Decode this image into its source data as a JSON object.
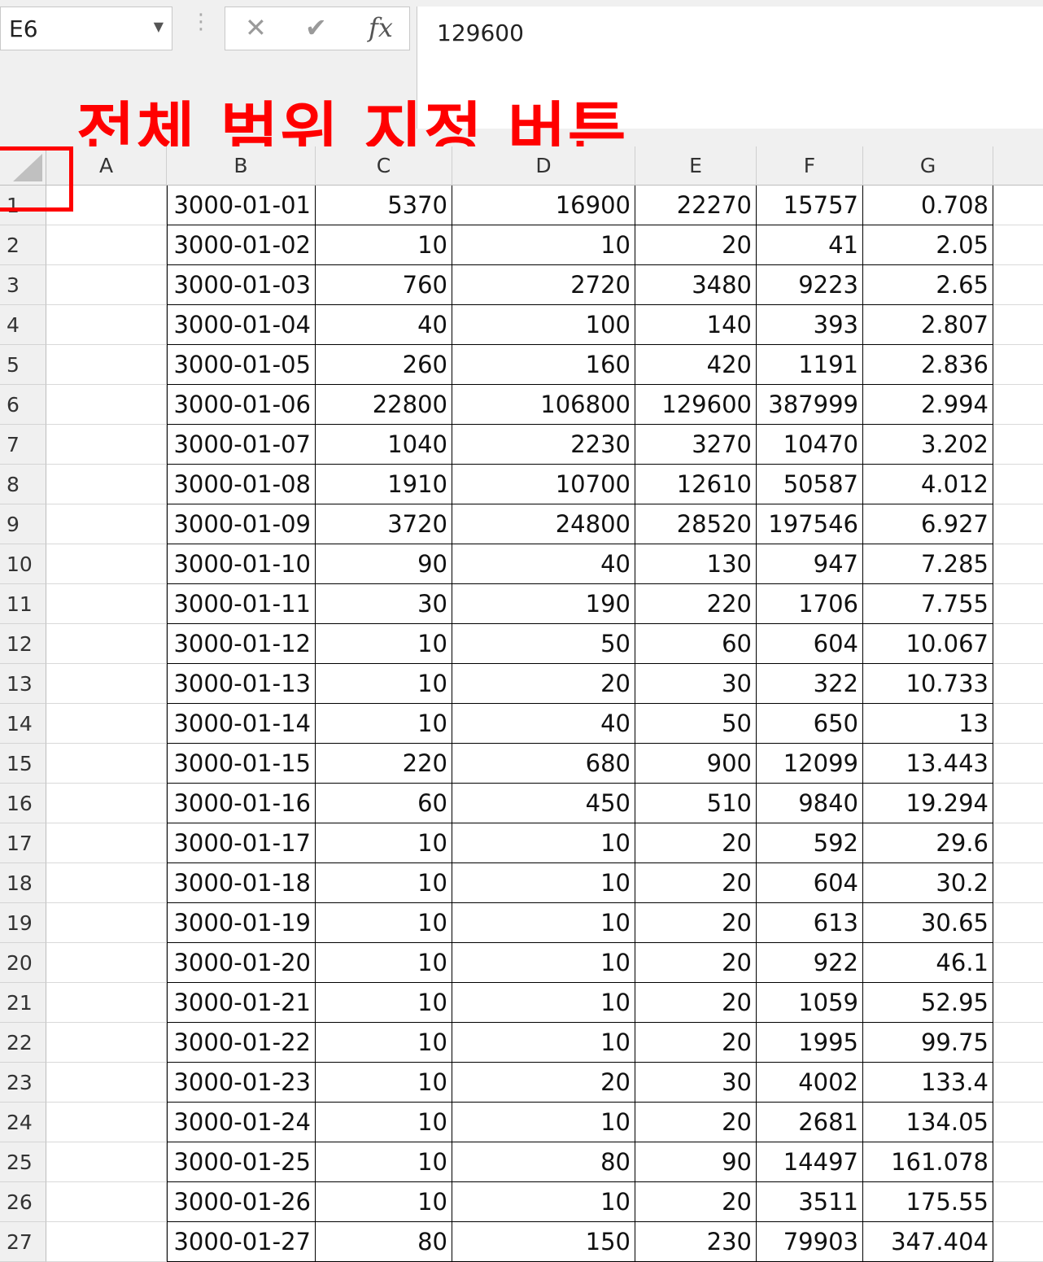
{
  "name_box": {
    "value": "E6",
    "dropdown_icon": "chevron-down-icon"
  },
  "formula_bar": {
    "cancel_icon": "close-icon",
    "enter_icon": "check-icon",
    "fx_label": "fx",
    "value": "129600"
  },
  "annotation": {
    "text": "전체 범위 지정 버튼",
    "color": "#ff0000"
  },
  "columns": [
    "A",
    "B",
    "C",
    "D",
    "E",
    "F",
    "G"
  ],
  "rows": [
    {
      "n": "1",
      "b": "3000-01-01",
      "c": "5370",
      "d": "16900",
      "e": "22270",
      "f": "15757",
      "g": "0.708"
    },
    {
      "n": "2",
      "b": "3000-01-02",
      "c": "10",
      "d": "10",
      "e": "20",
      "f": "41",
      "g": "2.05"
    },
    {
      "n": "3",
      "b": "3000-01-03",
      "c": "760",
      "d": "2720",
      "e": "3480",
      "f": "9223",
      "g": "2.65"
    },
    {
      "n": "4",
      "b": "3000-01-04",
      "c": "40",
      "d": "100",
      "e": "140",
      "f": "393",
      "g": "2.807"
    },
    {
      "n": "5",
      "b": "3000-01-05",
      "c": "260",
      "d": "160",
      "e": "420",
      "f": "1191",
      "g": "2.836"
    },
    {
      "n": "6",
      "b": "3000-01-06",
      "c": "22800",
      "d": "106800",
      "e": "129600",
      "f": "387999",
      "g": "2.994"
    },
    {
      "n": "7",
      "b": "3000-01-07",
      "c": "1040",
      "d": "2230",
      "e": "3270",
      "f": "10470",
      "g": "3.202"
    },
    {
      "n": "8",
      "b": "3000-01-08",
      "c": "1910",
      "d": "10700",
      "e": "12610",
      "f": "50587",
      "g": "4.012"
    },
    {
      "n": "9",
      "b": "3000-01-09",
      "c": "3720",
      "d": "24800",
      "e": "28520",
      "f": "197546",
      "g": "6.927"
    },
    {
      "n": "10",
      "b": "3000-01-10",
      "c": "90",
      "d": "40",
      "e": "130",
      "f": "947",
      "g": "7.285"
    },
    {
      "n": "11",
      "b": "3000-01-11",
      "c": "30",
      "d": "190",
      "e": "220",
      "f": "1706",
      "g": "7.755"
    },
    {
      "n": "12",
      "b": "3000-01-12",
      "c": "10",
      "d": "50",
      "e": "60",
      "f": "604",
      "g": "10.067"
    },
    {
      "n": "13",
      "b": "3000-01-13",
      "c": "10",
      "d": "20",
      "e": "30",
      "f": "322",
      "g": "10.733"
    },
    {
      "n": "14",
      "b": "3000-01-14",
      "c": "10",
      "d": "40",
      "e": "50",
      "f": "650",
      "g": "13"
    },
    {
      "n": "15",
      "b": "3000-01-15",
      "c": "220",
      "d": "680",
      "e": "900",
      "f": "12099",
      "g": "13.443"
    },
    {
      "n": "16",
      "b": "3000-01-16",
      "c": "60",
      "d": "450",
      "e": "510",
      "f": "9840",
      "g": "19.294"
    },
    {
      "n": "17",
      "b": "3000-01-17",
      "c": "10",
      "d": "10",
      "e": "20",
      "f": "592",
      "g": "29.6"
    },
    {
      "n": "18",
      "b": "3000-01-18",
      "c": "10",
      "d": "10",
      "e": "20",
      "f": "604",
      "g": "30.2"
    },
    {
      "n": "19",
      "b": "3000-01-19",
      "c": "10",
      "d": "10",
      "e": "20",
      "f": "613",
      "g": "30.65"
    },
    {
      "n": "20",
      "b": "3000-01-20",
      "c": "10",
      "d": "10",
      "e": "20",
      "f": "922",
      "g": "46.1"
    },
    {
      "n": "21",
      "b": "3000-01-21",
      "c": "10",
      "d": "10",
      "e": "20",
      "f": "1059",
      "g": "52.95"
    },
    {
      "n": "22",
      "b": "3000-01-22",
      "c": "10",
      "d": "10",
      "e": "20",
      "f": "1995",
      "g": "99.75"
    },
    {
      "n": "23",
      "b": "3000-01-23",
      "c": "10",
      "d": "20",
      "e": "30",
      "f": "4002",
      "g": "133.4"
    },
    {
      "n": "24",
      "b": "3000-01-24",
      "c": "10",
      "d": "10",
      "e": "20",
      "f": "2681",
      "g": "134.05"
    },
    {
      "n": "25",
      "b": "3000-01-25",
      "c": "10",
      "d": "80",
      "e": "90",
      "f": "14497",
      "g": "161.078"
    },
    {
      "n": "26",
      "b": "3000-01-26",
      "c": "10",
      "d": "10",
      "e": "20",
      "f": "3511",
      "g": "175.55"
    },
    {
      "n": "27",
      "b": "3000-01-27",
      "c": "80",
      "d": "150",
      "e": "230",
      "f": "79903",
      "g": "347.404"
    }
  ]
}
